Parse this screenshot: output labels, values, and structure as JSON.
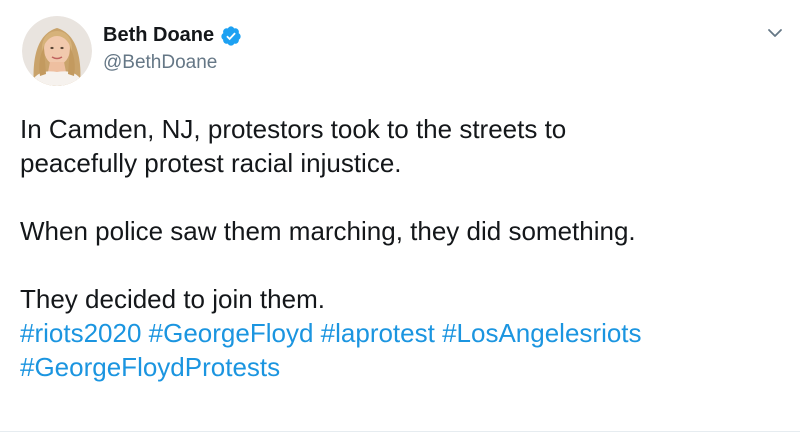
{
  "author": {
    "display_name": "Beth Doane",
    "handle": "@BethDoane",
    "verified": true,
    "verified_color": "#1da1f2"
  },
  "tweet": {
    "paragraph1": [
      "In Camden, NJ, protestors took to the streets to",
      "peacefully protest racial injustice."
    ],
    "paragraph2": "When police saw them marching, they did something.",
    "paragraph3": "They decided to join them.",
    "hashtags": [
      "#riots2020",
      "#GeorgeFloyd",
      "#laprotest",
      "#LosAngelesriots",
      "#GeorgeFloydProtests"
    ]
  },
  "icons": {
    "verified": "verified-badge-icon",
    "menu": "chevron-down-icon"
  },
  "colors": {
    "link": "#1b95e0",
    "text": "#14171a",
    "secondary": "#657786"
  }
}
